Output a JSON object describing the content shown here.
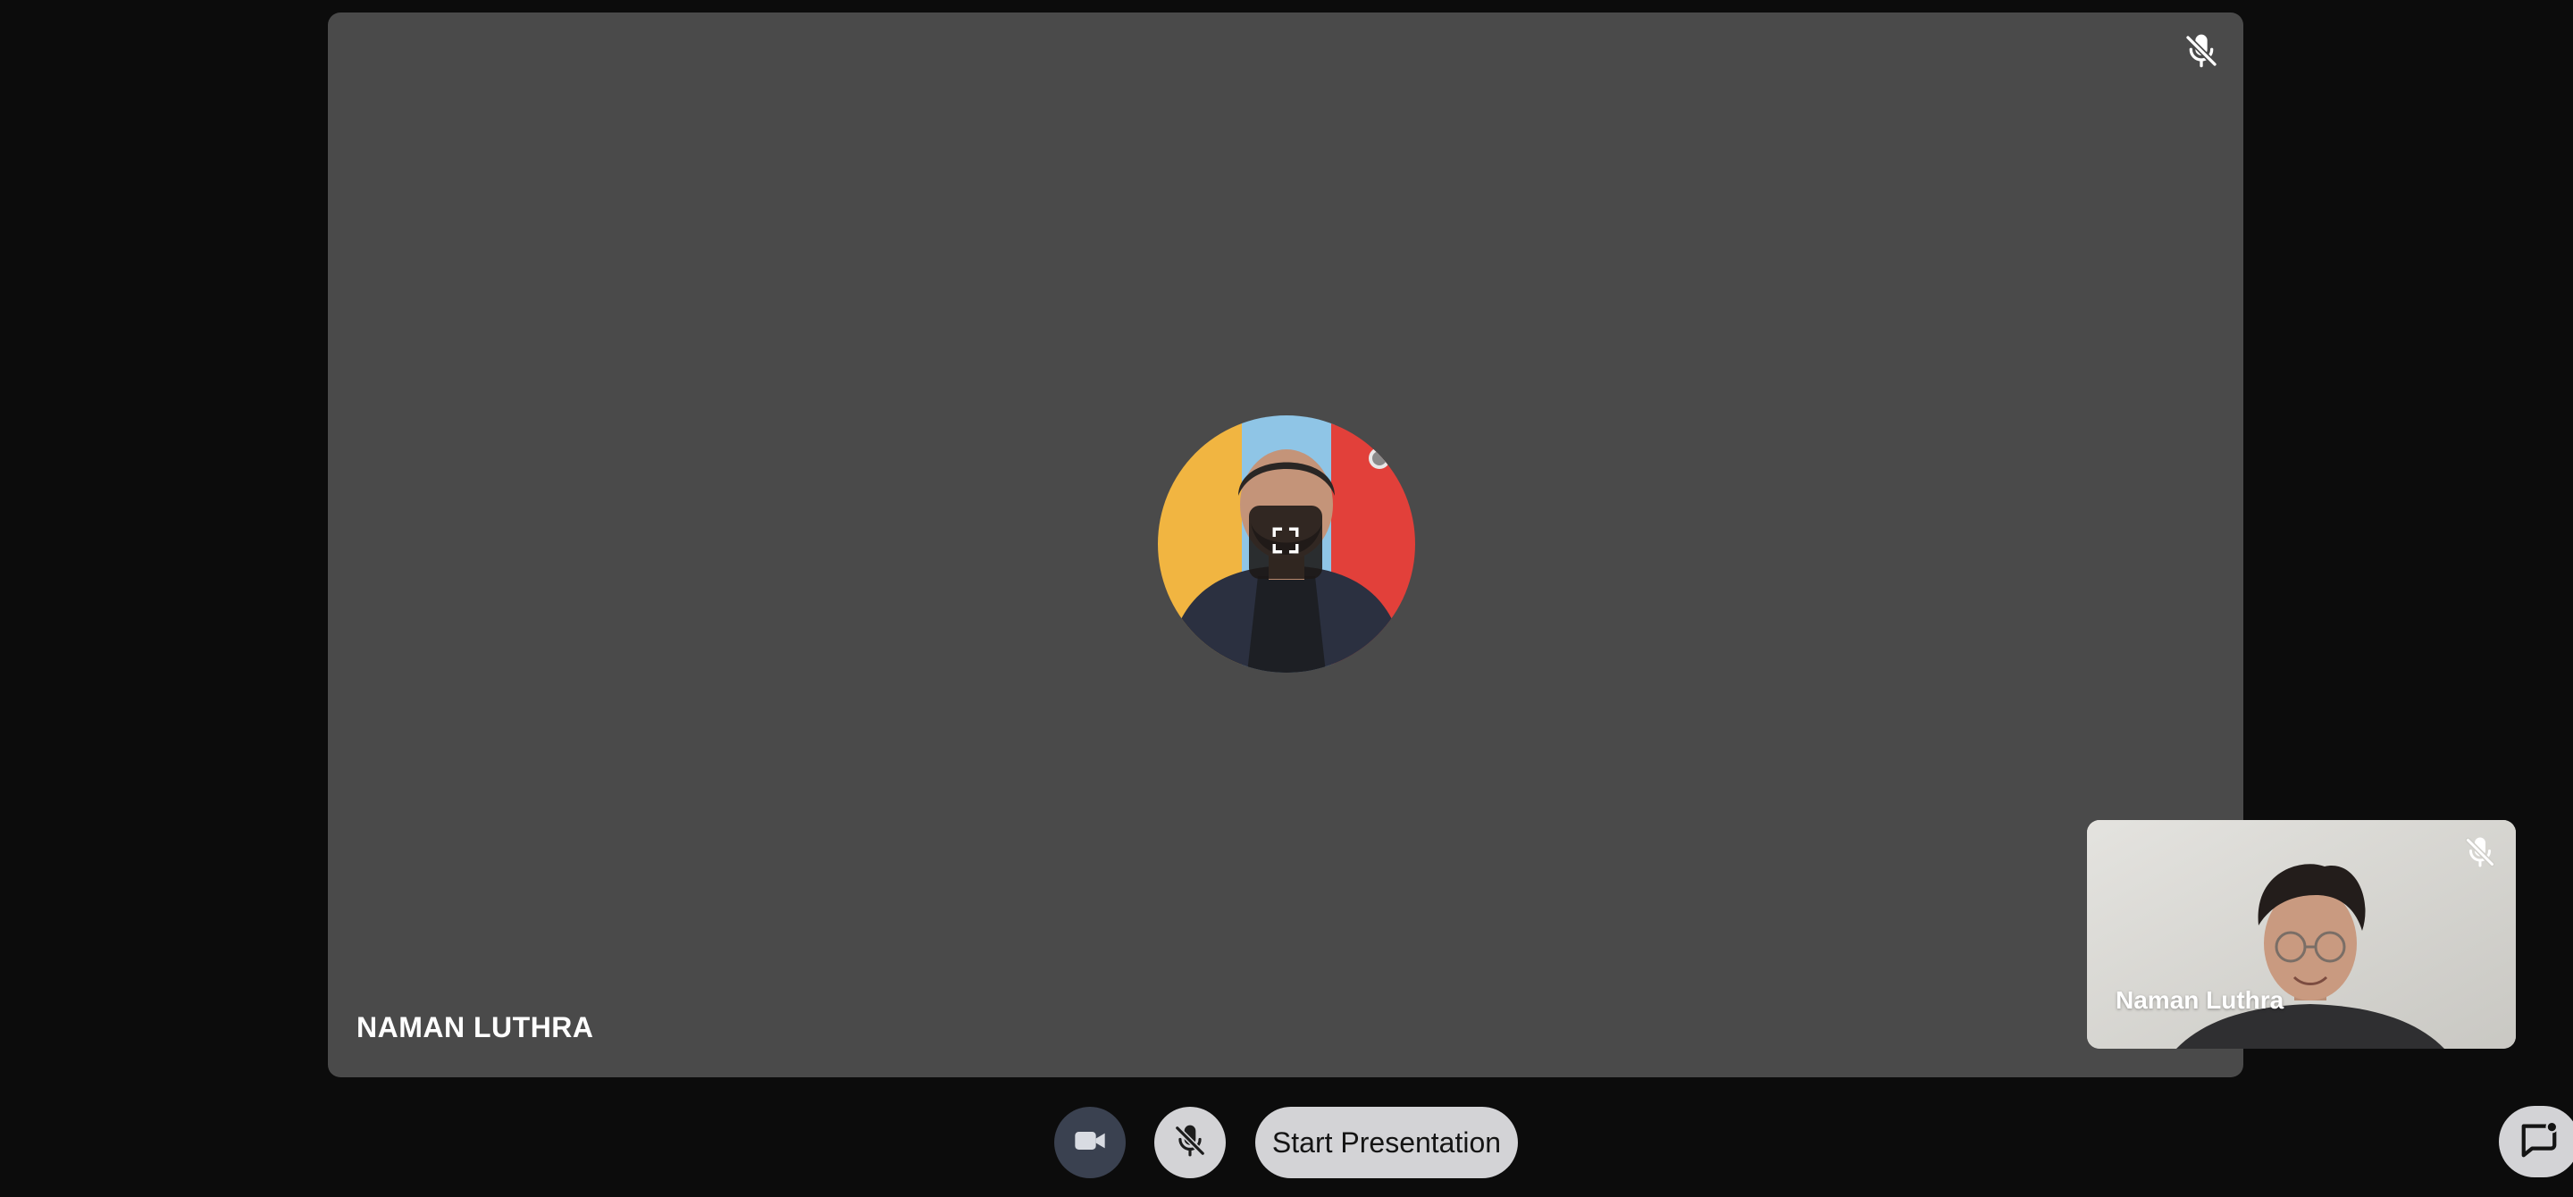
{
  "main_tile": {
    "participant_name": "NAMAN LUTHRA",
    "mic_status_icon": "mic-muted-icon",
    "expand_icon": "fullscreen-icon",
    "background_color": "#4a4a4a"
  },
  "self_tile": {
    "participant_name": "Naman Luthra",
    "mic_status_icon": "mic-muted-icon"
  },
  "controls": {
    "camera_icon": "video-camera-icon",
    "mic_icon": "mic-muted-icon",
    "present_label": "Start Presentation",
    "chat_icon": "chat-icon"
  },
  "colors": {
    "page_bg": "#0c0c0c",
    "tile_bg": "#4a4a4a",
    "camera_button_bg": "#3a4150",
    "light_button_bg": "#d3d3d6",
    "avatar_yellow": "#f1b541",
    "avatar_blue": "#8fc5e6",
    "avatar_red": "#e2403a"
  }
}
